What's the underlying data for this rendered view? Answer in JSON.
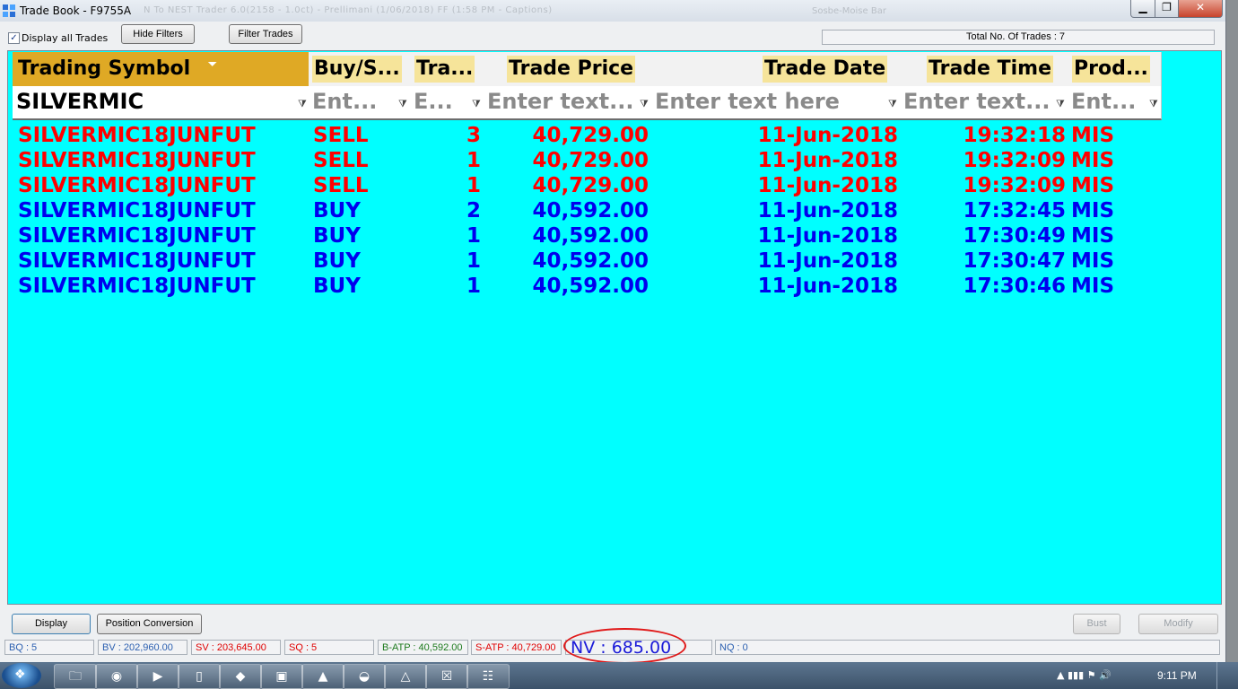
{
  "window": {
    "title": "Trade Book - F9755A",
    "blurred_title_text": "N To NEST Trader 6.0(2158 - 1.0ct) - Prellimani (1/06/2018) FF (1:58 PM - Captions)",
    "blurred_title_text_right": "Sosbe-Moise Bar"
  },
  "toolbar": {
    "display_all_label": "Display all Trades",
    "display_all_checked": "✓",
    "hide_filters": "Hide Filters",
    "filter_trades": "Filter Trades",
    "total_trades": "Total No. Of Trades : 7"
  },
  "columns": [
    {
      "label": "Trading Symbol",
      "filter": "SILVERMIC"
    },
    {
      "label": "Buy/S...",
      "filter": "Ent..."
    },
    {
      "label": "Tra...",
      "filter": "E..."
    },
    {
      "label": "Trade Price",
      "filter": "Enter text..."
    },
    {
      "label": "Trade Date",
      "filter": "Enter text here"
    },
    {
      "label": "Trade Time",
      "filter": "Enter text..."
    },
    {
      "label": "Prod...",
      "filter": "Ent..."
    }
  ],
  "rows": [
    {
      "symbol": "SILVERMIC18JUNFUT",
      "side": "SELL",
      "qty": "3",
      "price": "40,729.00",
      "date": "11-Jun-2018",
      "time": "19:32:18",
      "product": "MIS"
    },
    {
      "symbol": "SILVERMIC18JUNFUT",
      "side": "SELL",
      "qty": "1",
      "price": "40,729.00",
      "date": "11-Jun-2018",
      "time": "19:32:09",
      "product": "MIS"
    },
    {
      "symbol": "SILVERMIC18JUNFUT",
      "side": "SELL",
      "qty": "1",
      "price": "40,729.00",
      "date": "11-Jun-2018",
      "time": "19:32:09",
      "product": "MIS"
    },
    {
      "symbol": "SILVERMIC18JUNFUT",
      "side": "BUY",
      "qty": "2",
      "price": "40,592.00",
      "date": "11-Jun-2018",
      "time": "17:32:45",
      "product": "MIS"
    },
    {
      "symbol": "SILVERMIC18JUNFUT",
      "side": "BUY",
      "qty": "1",
      "price": "40,592.00",
      "date": "11-Jun-2018",
      "time": "17:30:49",
      "product": "MIS"
    },
    {
      "symbol": "SILVERMIC18JUNFUT",
      "side": "BUY",
      "qty": "1",
      "price": "40,592.00",
      "date": "11-Jun-2018",
      "time": "17:30:47",
      "product": "MIS"
    },
    {
      "symbol": "SILVERMIC18JUNFUT",
      "side": "BUY",
      "qty": "1",
      "price": "40,592.00",
      "date": "11-Jun-2018",
      "time": "17:30:46",
      "product": "MIS"
    }
  ],
  "bottom": {
    "display": "Display",
    "position_conversion": "Position Conversion",
    "bust": "Bust",
    "modify": "Modify"
  },
  "status": {
    "bq": "BQ : 5",
    "bv": "BV : 202,960.00",
    "sv": "SV : 203,645.00",
    "sq": "SQ : 5",
    "batp": "B-ATP : 40,592.00",
    "satp": "S-ATP : 40,729.00",
    "nv": "NV : 685.00",
    "nq": "NQ : 0"
  },
  "colors": {
    "sell": "#ff0000",
    "buy": "#0000ee",
    "grid_bg": "#00ffff",
    "header_label_bg": "#f6e49a",
    "sorted_header_bg": "#dfa925",
    "nv_highlight": "#e01818"
  },
  "taskbar": {
    "clock": "9:11 PM"
  }
}
